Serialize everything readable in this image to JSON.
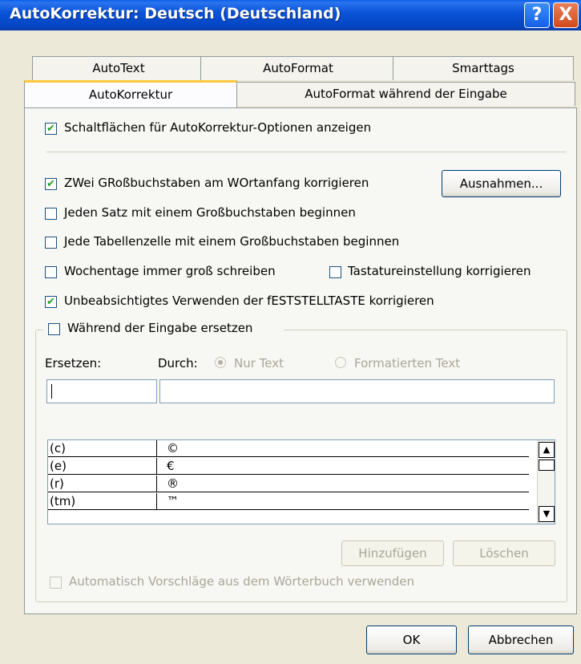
{
  "window": {
    "title": "AutoKorrektur: Deutsch (Deutschland)"
  },
  "titlebar_buttons": {
    "help": "?",
    "close": "X"
  },
  "tabs": {
    "row1": [
      "AutoText",
      "AutoFormat",
      "Smarttags"
    ],
    "row2": [
      "AutoKorrektur",
      "AutoFormat während der Eingabe"
    ],
    "active": "AutoKorrektur"
  },
  "options": {
    "show_buttons": {
      "label": "Schaltflächen für AutoKorrektur-Optionen anzeigen",
      "checked": true
    },
    "two_caps": {
      "label": "ZWei GRoßbuchstaben am WOrtanfang korrigieren",
      "checked": true
    },
    "sentence_cap": {
      "label": "Jeden Satz mit einem Großbuchstaben beginnen",
      "checked": false
    },
    "table_cell_cap": {
      "label": "Jede Tabellenzelle mit einem Großbuchstaben beginnen",
      "checked": false
    },
    "weekdays": {
      "label": "Wochentage immer groß schreiben",
      "checked": false
    },
    "keyboard": {
      "label": "Tastatureinstellung korrigieren",
      "checked": false
    },
    "capslock": {
      "label": "Unbeabsichtigtes Verwenden der fESTSTELLTASTE korrigieren",
      "checked": true
    },
    "replace_while_typing": {
      "label": "Während der Eingabe ersetzen",
      "checked": false
    }
  },
  "exceptions_button": "Ausnahmen...",
  "replace": {
    "ersetzen_label": "Ersetzen:",
    "durch_label": "Durch:",
    "radio_plain": "Nur Text",
    "radio_formatted": "Formatierten Text",
    "ersetzen_value": "",
    "durch_value": ""
  },
  "entries": [
    {
      "from": "(c)",
      "to": "©"
    },
    {
      "from": "(e)",
      "to": "€"
    },
    {
      "from": "(r)",
      "to": "®"
    },
    {
      "from": "(tm)",
      "to": "™"
    }
  ],
  "scroll": {
    "up": "▲",
    "down": "▼"
  },
  "buttons": {
    "add": "Hinzufügen",
    "delete": "Löschen",
    "ok": "OK",
    "cancel": "Abbrechen"
  },
  "dictionary_option": {
    "label": "Automatisch Vorschläge aus dem Wörterbuch verwenden",
    "checked": false
  },
  "check_mark": "✔"
}
